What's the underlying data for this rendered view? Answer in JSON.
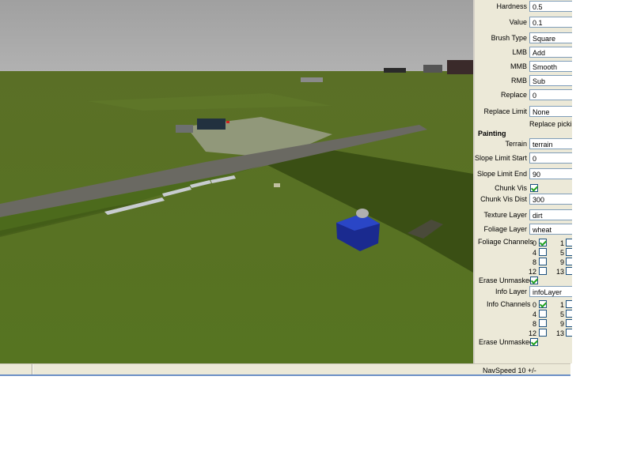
{
  "panel": {
    "hardness": {
      "label": "Hardness",
      "value": "0.5"
    },
    "value": {
      "label": "Value",
      "value": "0.1"
    },
    "brush_type": {
      "label": "Brush Type",
      "value": "Square"
    },
    "lmb": {
      "label": "LMB",
      "value": "Add"
    },
    "mmb": {
      "label": "MMB",
      "value": "Smooth"
    },
    "rmb": {
      "label": "RMB",
      "value": "Sub"
    },
    "replace": {
      "label": "Replace",
      "value": "0"
    },
    "replace_limit": {
      "label": "Replace Limit",
      "value": "None"
    },
    "replace_picking": "Replace picking",
    "painting": {
      "title": "Painting",
      "terrain": {
        "label": "Terrain",
        "value": "terrain"
      },
      "slope_limit_start": {
        "label": "Slope Limit Start",
        "value": "0"
      },
      "slope_limit_end": {
        "label": "Slope Limit End",
        "value": "90"
      },
      "chunk_vis": {
        "label": "Chunk Vis",
        "checked": true
      },
      "chunk_vis_dist": {
        "label": "Chunk Vis Dist",
        "value": "300"
      },
      "texture_layer": {
        "label": "Texture Layer",
        "value": "dirt"
      },
      "foliage_layer": {
        "label": "Foliage Layer",
        "value": "wheat"
      },
      "foliage_channels": {
        "label": "Foliage Channels",
        "items": [
          {
            "n": "0",
            "checked": true
          },
          {
            "n": "1",
            "checked": false
          },
          {
            "n": "4",
            "checked": false
          },
          {
            "n": "5",
            "checked": false
          },
          {
            "n": "8",
            "checked": false
          },
          {
            "n": "9",
            "checked": false
          },
          {
            "n": "12",
            "checked": false
          },
          {
            "n": "13",
            "checked": false
          }
        ]
      },
      "erase_unmasked_1": {
        "label": "Erase Unmasked",
        "checked": true
      },
      "info_layer": {
        "label": "Info Layer",
        "value": "infoLayer"
      },
      "info_channels": {
        "label": "Info Channels",
        "items": [
          {
            "n": "0",
            "checked": true
          },
          {
            "n": "1",
            "checked": false
          },
          {
            "n": "4",
            "checked": false
          },
          {
            "n": "5",
            "checked": false
          },
          {
            "n": "8",
            "checked": false
          },
          {
            "n": "9",
            "checked": false
          },
          {
            "n": "12",
            "checked": false
          },
          {
            "n": "13",
            "checked": false
          }
        ]
      },
      "erase_unmasked_2": {
        "label": "Erase Unmasked",
        "checked": true
      }
    }
  },
  "statusbar": {
    "nav_speed": "NavSpeed 10 +/-"
  },
  "colors": {
    "sky": "#a6a6a6",
    "grass": "#56701f",
    "field_dark": "#3e5417",
    "road": "#6b6a64",
    "panel_bg": "#ece9d8",
    "accent_border": "#6b8fc6"
  }
}
